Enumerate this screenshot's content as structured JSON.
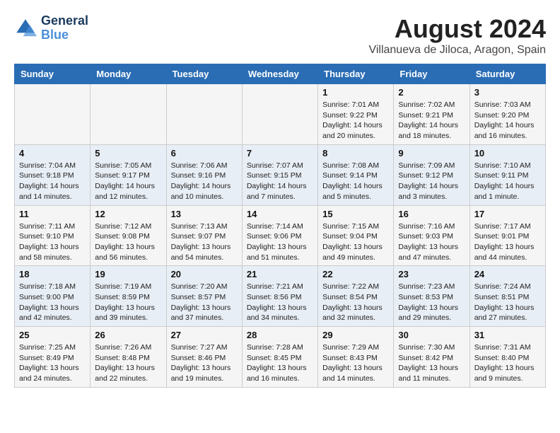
{
  "header": {
    "logo_line1": "General",
    "logo_line2": "Blue",
    "month_year": "August 2024",
    "location": "Villanueva de Jiloca, Aragon, Spain"
  },
  "weekdays": [
    "Sunday",
    "Monday",
    "Tuesday",
    "Wednesday",
    "Thursday",
    "Friday",
    "Saturday"
  ],
  "weeks": [
    [
      {
        "day": "",
        "info": ""
      },
      {
        "day": "",
        "info": ""
      },
      {
        "day": "",
        "info": ""
      },
      {
        "day": "",
        "info": ""
      },
      {
        "day": "1",
        "info": "Sunrise: 7:01 AM\nSunset: 9:22 PM\nDaylight: 14 hours\nand 20 minutes."
      },
      {
        "day": "2",
        "info": "Sunrise: 7:02 AM\nSunset: 9:21 PM\nDaylight: 14 hours\nand 18 minutes."
      },
      {
        "day": "3",
        "info": "Sunrise: 7:03 AM\nSunset: 9:20 PM\nDaylight: 14 hours\nand 16 minutes."
      }
    ],
    [
      {
        "day": "4",
        "info": "Sunrise: 7:04 AM\nSunset: 9:18 PM\nDaylight: 14 hours\nand 14 minutes."
      },
      {
        "day": "5",
        "info": "Sunrise: 7:05 AM\nSunset: 9:17 PM\nDaylight: 14 hours\nand 12 minutes."
      },
      {
        "day": "6",
        "info": "Sunrise: 7:06 AM\nSunset: 9:16 PM\nDaylight: 14 hours\nand 10 minutes."
      },
      {
        "day": "7",
        "info": "Sunrise: 7:07 AM\nSunset: 9:15 PM\nDaylight: 14 hours\nand 7 minutes."
      },
      {
        "day": "8",
        "info": "Sunrise: 7:08 AM\nSunset: 9:14 PM\nDaylight: 14 hours\nand 5 minutes."
      },
      {
        "day": "9",
        "info": "Sunrise: 7:09 AM\nSunset: 9:12 PM\nDaylight: 14 hours\nand 3 minutes."
      },
      {
        "day": "10",
        "info": "Sunrise: 7:10 AM\nSunset: 9:11 PM\nDaylight: 14 hours\nand 1 minute."
      }
    ],
    [
      {
        "day": "11",
        "info": "Sunrise: 7:11 AM\nSunset: 9:10 PM\nDaylight: 13 hours\nand 58 minutes."
      },
      {
        "day": "12",
        "info": "Sunrise: 7:12 AM\nSunset: 9:08 PM\nDaylight: 13 hours\nand 56 minutes."
      },
      {
        "day": "13",
        "info": "Sunrise: 7:13 AM\nSunset: 9:07 PM\nDaylight: 13 hours\nand 54 minutes."
      },
      {
        "day": "14",
        "info": "Sunrise: 7:14 AM\nSunset: 9:06 PM\nDaylight: 13 hours\nand 51 minutes."
      },
      {
        "day": "15",
        "info": "Sunrise: 7:15 AM\nSunset: 9:04 PM\nDaylight: 13 hours\nand 49 minutes."
      },
      {
        "day": "16",
        "info": "Sunrise: 7:16 AM\nSunset: 9:03 PM\nDaylight: 13 hours\nand 47 minutes."
      },
      {
        "day": "17",
        "info": "Sunrise: 7:17 AM\nSunset: 9:01 PM\nDaylight: 13 hours\nand 44 minutes."
      }
    ],
    [
      {
        "day": "18",
        "info": "Sunrise: 7:18 AM\nSunset: 9:00 PM\nDaylight: 13 hours\nand 42 minutes."
      },
      {
        "day": "19",
        "info": "Sunrise: 7:19 AM\nSunset: 8:59 PM\nDaylight: 13 hours\nand 39 minutes."
      },
      {
        "day": "20",
        "info": "Sunrise: 7:20 AM\nSunset: 8:57 PM\nDaylight: 13 hours\nand 37 minutes."
      },
      {
        "day": "21",
        "info": "Sunrise: 7:21 AM\nSunset: 8:56 PM\nDaylight: 13 hours\nand 34 minutes."
      },
      {
        "day": "22",
        "info": "Sunrise: 7:22 AM\nSunset: 8:54 PM\nDaylight: 13 hours\nand 32 minutes."
      },
      {
        "day": "23",
        "info": "Sunrise: 7:23 AM\nSunset: 8:53 PM\nDaylight: 13 hours\nand 29 minutes."
      },
      {
        "day": "24",
        "info": "Sunrise: 7:24 AM\nSunset: 8:51 PM\nDaylight: 13 hours\nand 27 minutes."
      }
    ],
    [
      {
        "day": "25",
        "info": "Sunrise: 7:25 AM\nSunset: 8:49 PM\nDaylight: 13 hours\nand 24 minutes."
      },
      {
        "day": "26",
        "info": "Sunrise: 7:26 AM\nSunset: 8:48 PM\nDaylight: 13 hours\nand 22 minutes."
      },
      {
        "day": "27",
        "info": "Sunrise: 7:27 AM\nSunset: 8:46 PM\nDaylight: 13 hours\nand 19 minutes."
      },
      {
        "day": "28",
        "info": "Sunrise: 7:28 AM\nSunset: 8:45 PM\nDaylight: 13 hours\nand 16 minutes."
      },
      {
        "day": "29",
        "info": "Sunrise: 7:29 AM\nSunset: 8:43 PM\nDaylight: 13 hours\nand 14 minutes."
      },
      {
        "day": "30",
        "info": "Sunrise: 7:30 AM\nSunset: 8:42 PM\nDaylight: 13 hours\nand 11 minutes."
      },
      {
        "day": "31",
        "info": "Sunrise: 7:31 AM\nSunset: 8:40 PM\nDaylight: 13 hours\nand 9 minutes."
      }
    ]
  ]
}
